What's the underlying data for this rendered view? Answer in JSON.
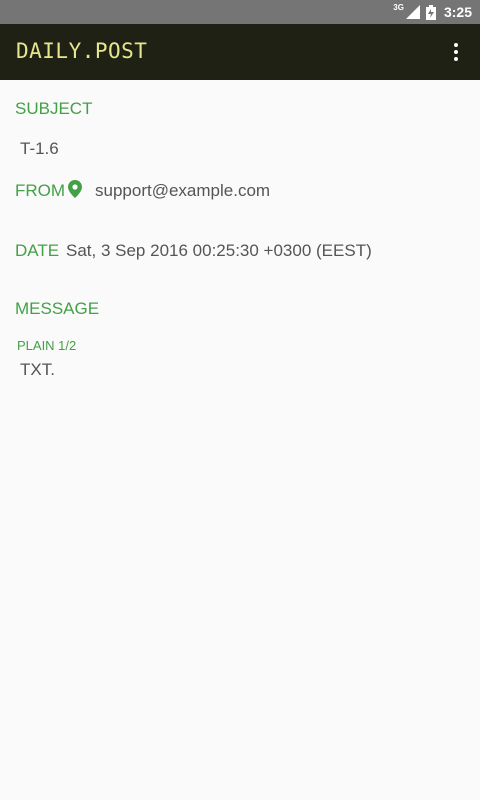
{
  "status_bar": {
    "network": "3G",
    "time": "3:25",
    "icons": [
      "signal-icon",
      "battery-icon"
    ]
  },
  "toolbar": {
    "title": "DAILY.POST",
    "menu_icon": "more-vert-icon"
  },
  "colors": {
    "accent": "#43a047",
    "title_text": "#e6e68c",
    "toolbar_bg": "#1e2113",
    "status_bg": "#757575"
  },
  "email": {
    "subject_label": "SUBJECT",
    "subject": "T-1.6",
    "from_label": "FROM",
    "from": "support@example.com",
    "from_icon": "location-pin-icon",
    "date_label": "DATE",
    "date": "Sat, 3 Sep 2016 00:25:30 +0300 (EEST)",
    "message_label": "MESSAGE",
    "part_label": "PLAIN 1/2",
    "body": "TXT."
  }
}
